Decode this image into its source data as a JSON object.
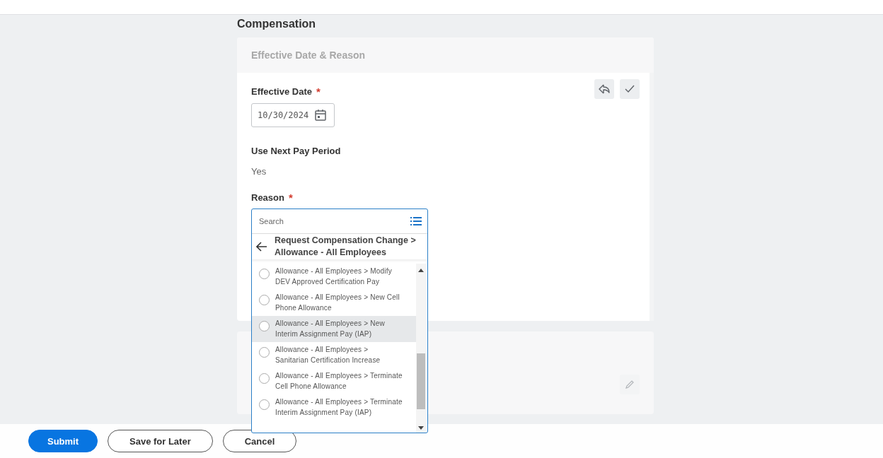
{
  "page": {
    "title": "Compensation"
  },
  "effective_card": {
    "title": "Effective Date & Reason",
    "effective_date": {
      "label": "Effective Date",
      "required_marker": "*",
      "value": "10/30/2024"
    },
    "next_pay_period": {
      "label": "Use Next Pay Period",
      "value": "Yes"
    },
    "reason": {
      "label": "Reason",
      "required_marker": "*"
    }
  },
  "reason_dropdown": {
    "search_placeholder": "Search",
    "breadcrumb": "Request Compensation Change > Allowance - All Employees",
    "options": [
      {
        "label": "Allowance - All Employees > Modify DEV Approved Certification Pay",
        "highlighted": false,
        "selected": false
      },
      {
        "label": "Allowance - All Employees > New Cell Phone Allowance",
        "highlighted": false,
        "selected": false
      },
      {
        "label": "Allowance - All Employees > New Interim Assignment Pay (IAP)",
        "highlighted": true,
        "selected": false
      },
      {
        "label": "Allowance - All Employees > Sanitarian Certification Increase",
        "highlighted": false,
        "selected": false
      },
      {
        "label": "Allowance - All Employees > Terminate Cell Phone Allowance",
        "highlighted": false,
        "selected": false
      },
      {
        "label": "Allowance - All Employees > Terminate Interim Assignment Pay (IAP)",
        "highlighted": false,
        "selected": false
      }
    ]
  },
  "footer": {
    "buttons": [
      {
        "label": "Submit",
        "kind": "primary"
      },
      {
        "label": "Save for Later",
        "kind": "secondary"
      },
      {
        "label": "Cancel",
        "kind": "secondary"
      }
    ]
  }
}
